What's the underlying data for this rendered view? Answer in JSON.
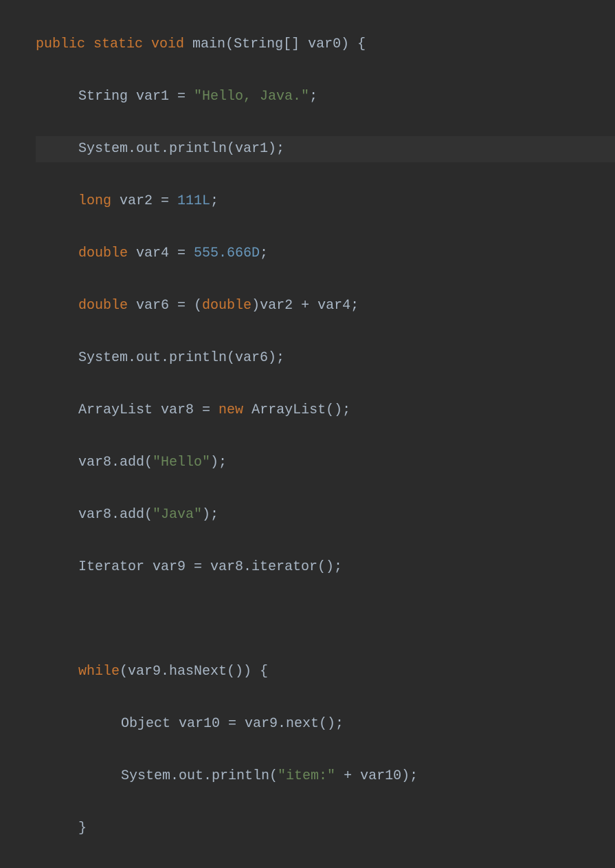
{
  "code": {
    "line1": {
      "kw1": "public static void",
      "method": " main",
      "params": "(String[] var0) {"
    },
    "line2": {
      "type": "String var1 = ",
      "str": "\"Hello, Java.\"",
      "semi": ";"
    },
    "line3": {
      "text": "System.out.println(var1);"
    },
    "line4": {
      "kw": "long",
      "var": " var2 = ",
      "num": "111L",
      "semi": ";"
    },
    "line5": {
      "kw": "double",
      "var": " var4 = ",
      "num": "555.666D",
      "semi": ";"
    },
    "line6": {
      "kw": "double",
      "var": " var6 = (",
      "kw2": "double",
      "rest": ")var2 + var4;"
    },
    "line7": {
      "text": "System.out.println(var6);"
    },
    "line8": {
      "type": "ArrayList var8 = ",
      "kw": "new",
      "rest": " ArrayList();"
    },
    "line9": {
      "pre": "var8.add(",
      "str": "\"Hello\"",
      "post": ");"
    },
    "line10": {
      "pre": "var8.add(",
      "str": "\"Java\"",
      "post": ");"
    },
    "line11": {
      "text": "Iterator var9 = var8.iterator();"
    },
    "line12": {
      "text": ""
    },
    "line13": {
      "kw": "while",
      "rest": "(var9.hasNext()) {"
    },
    "line14": {
      "text": "Object var10 = var9.next();"
    },
    "line15": {
      "pre": "System.out.println(",
      "str": "\"item:\"",
      "post": " + var10);"
    },
    "line16": {
      "text": "}"
    }
  }
}
